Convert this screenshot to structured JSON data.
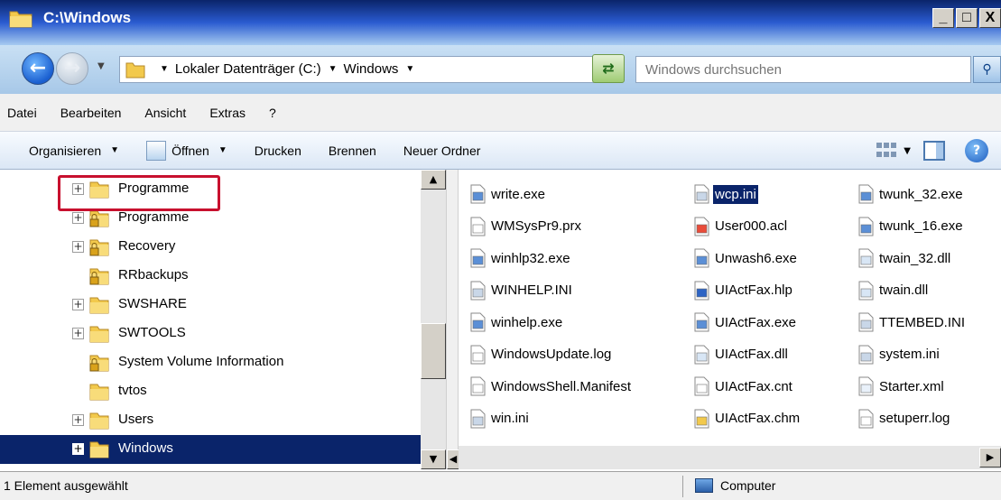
{
  "window": {
    "title": "C:\\Windows",
    "minimize": "_",
    "maximize": "□",
    "close": "X"
  },
  "address": {
    "crumbs": [
      "Lokaler Datenträger (C:)",
      "Windows"
    ],
    "search_placeholder": "Windows durchsuchen"
  },
  "menu": [
    "Datei",
    "Bearbeiten",
    "Ansicht",
    "Extras",
    "?"
  ],
  "toolbar": {
    "organize": "Organisieren",
    "open": "Öffnen",
    "print": "Drucken",
    "burn": "Brennen",
    "new_folder": "Neuer Ordner"
  },
  "tree": [
    {
      "label": "Programme",
      "expand": "+",
      "locked": false,
      "selected": false,
      "highlighted": true
    },
    {
      "label": "Programme",
      "expand": "+",
      "locked": true,
      "selected": false
    },
    {
      "label": "Recovery",
      "expand": "+",
      "locked": true,
      "selected": false
    },
    {
      "label": "RRbackups",
      "expand": "",
      "locked": true,
      "selected": false
    },
    {
      "label": "SWSHARE",
      "expand": "+",
      "locked": false,
      "selected": false
    },
    {
      "label": "SWTOOLS",
      "expand": "+",
      "locked": false,
      "selected": false
    },
    {
      "label": "System Volume Information",
      "expand": "",
      "locked": true,
      "selected": false
    },
    {
      "label": "tvtos",
      "expand": "",
      "locked": false,
      "selected": false
    },
    {
      "label": "Users",
      "expand": "+",
      "locked": false,
      "selected": false
    },
    {
      "label": "Windows",
      "expand": "+",
      "locked": false,
      "selected": true
    }
  ],
  "files": {
    "col1": [
      "write.exe",
      "WMSysPr9.prx",
      "winhlp32.exe",
      "WINHELP.INI",
      "winhelp.exe",
      "WindowsUpdate.log",
      "WindowsShell.Manifest",
      "win.ini"
    ],
    "col2": [
      "wcp.ini",
      "User000.acl",
      "Unwash6.exe",
      "UIActFax.hlp",
      "UIActFax.exe",
      "UIActFax.dll",
      "UIActFax.cnt",
      "UIActFax.chm"
    ],
    "col3": [
      "twunk_32.exe",
      "twunk_16.exe",
      "twain_32.dll",
      "twain.dll",
      "TTEMBED.INI",
      "system.ini",
      "Starter.xml",
      "setuperr.log"
    ],
    "selected": "wcp.ini"
  },
  "status": {
    "left": "1 Element ausgewählt",
    "right": "Computer"
  },
  "colors": {
    "selection": "#0a246a",
    "highlight_box": "#c8102e",
    "folder": "#f2c94c"
  }
}
